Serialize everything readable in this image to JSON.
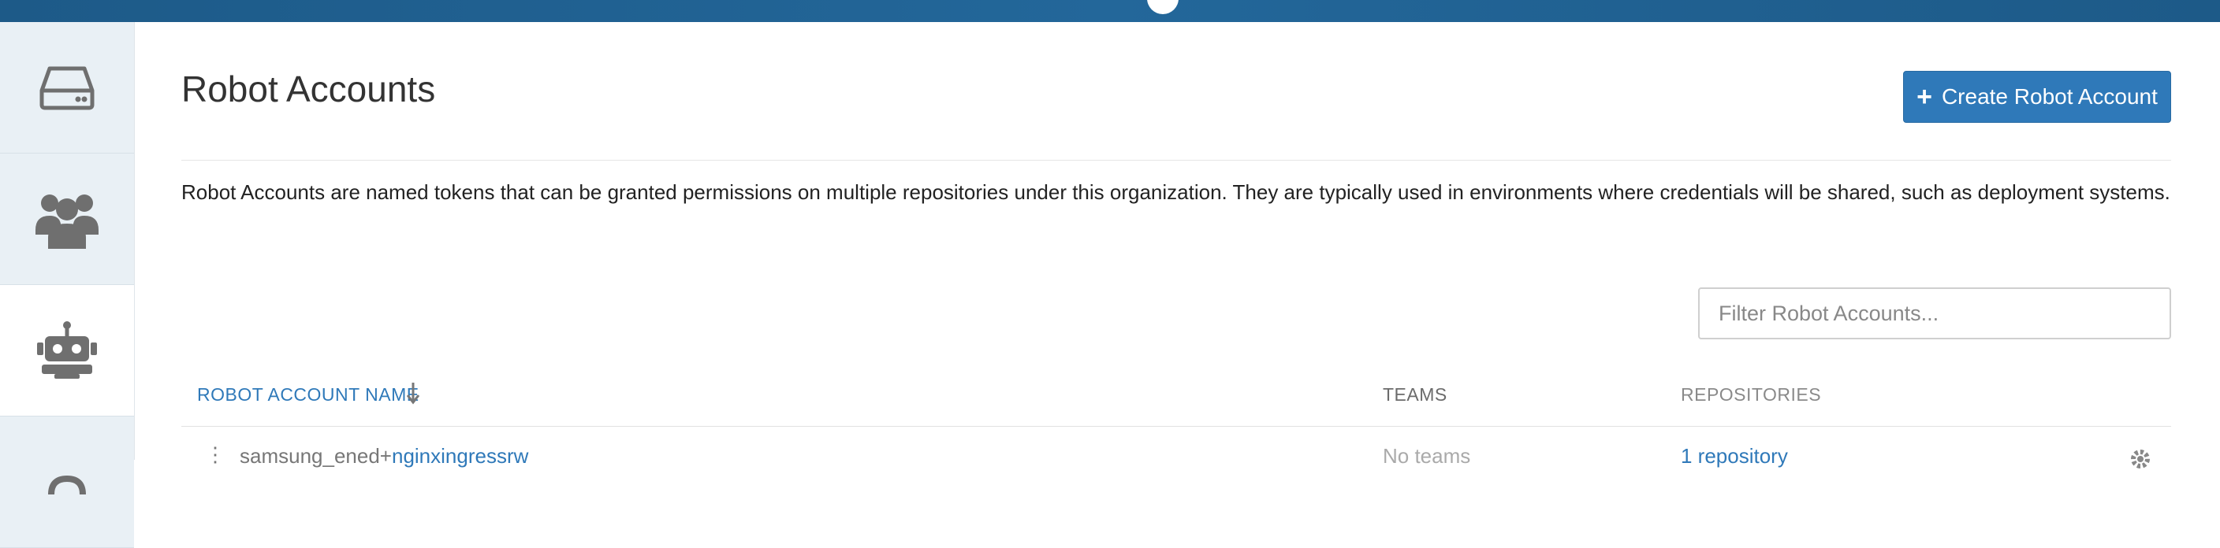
{
  "page": {
    "title": "Robot Accounts",
    "description": "Robot Accounts are named tokens that can be granted permissions on multiple repositories under this organization. They are typically used in environments where credentials will be shared, such as deployment systems."
  },
  "toolbar": {
    "create_label": "Create Robot Account"
  },
  "filter": {
    "placeholder": "Filter Robot Accounts..."
  },
  "sidebar": {
    "items": [
      {
        "icon": "hard-drive-icon"
      },
      {
        "icon": "users-icon"
      },
      {
        "icon": "robot-icon",
        "active": true
      },
      {
        "icon": "partial-icon"
      }
    ]
  },
  "table": {
    "headers": {
      "name": "ROBOT ACCOUNT NAME",
      "teams": "TEAMS",
      "repositories": "REPOSITORIES"
    },
    "rows": [
      {
        "prefix": "samsung_ened+",
        "name": "nginxingressrw",
        "teams": "No teams",
        "repositories": "1 repository"
      }
    ]
  },
  "colors": {
    "accent": "#2f79b9",
    "topbar": "#1f5f8f",
    "sidebar_bg": "#e9f0f5"
  }
}
